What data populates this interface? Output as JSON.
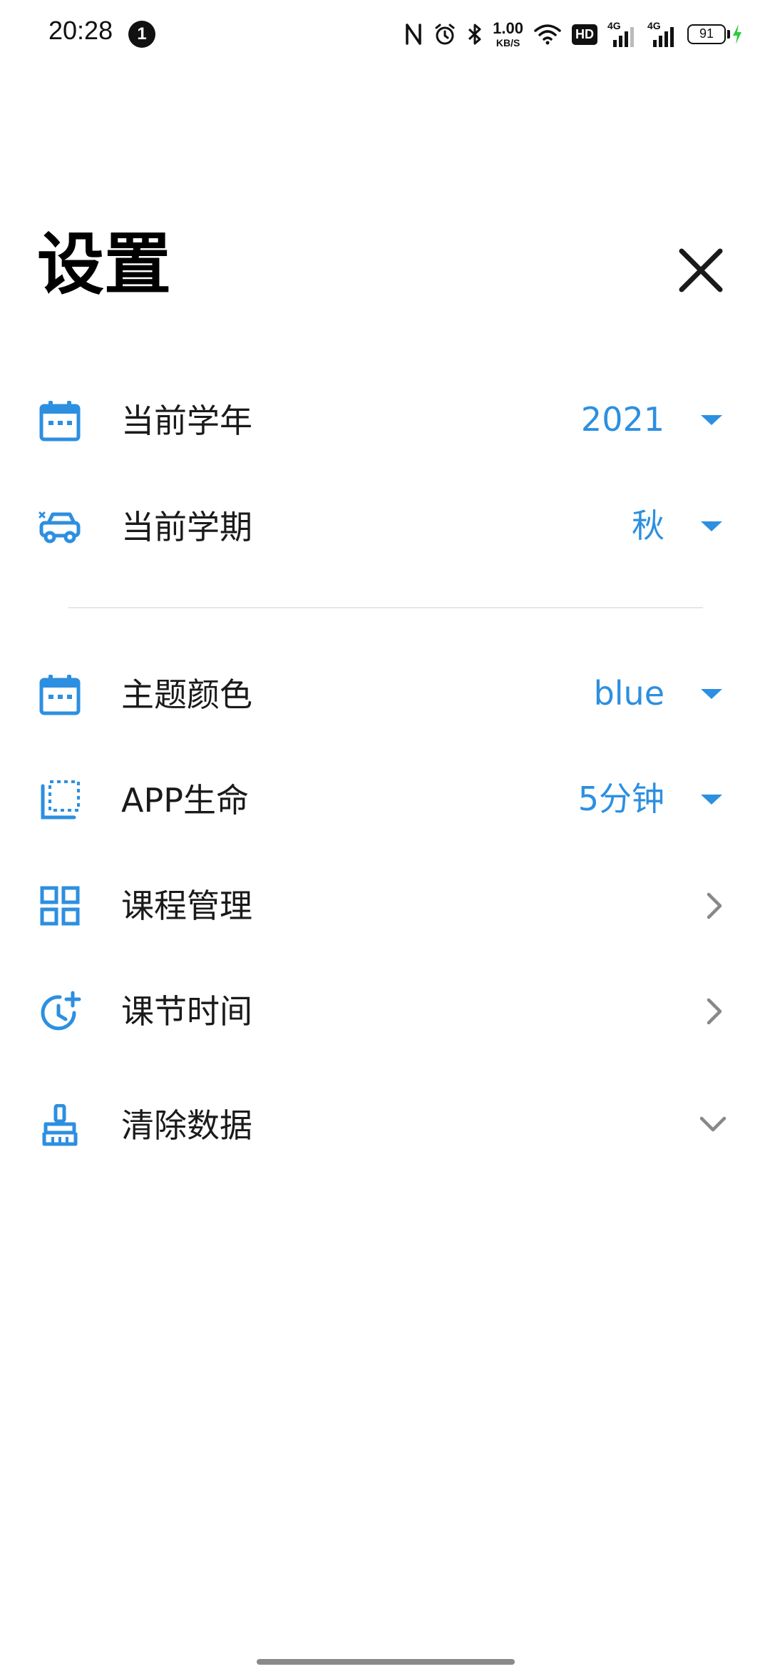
{
  "status_bar": {
    "time": "20:28",
    "notification_count": "1",
    "net_speed_value": "1.00",
    "net_speed_unit": "KB/S",
    "hd_label": "HD",
    "sim1_label": "4G",
    "sim2_label": "4G",
    "battery_level": "91"
  },
  "header": {
    "title": "设置"
  },
  "settings": {
    "items": [
      {
        "label": "当前学年",
        "value": "2021",
        "icon": "calendar-icon",
        "control": "dropdown"
      },
      {
        "label": "当前学期",
        "value": "秋",
        "icon": "car-icon",
        "control": "dropdown"
      },
      {
        "label": "主题颜色",
        "value": "blue",
        "icon": "calendar-icon",
        "control": "dropdown"
      },
      {
        "label": "APP生命",
        "value": "5分钟",
        "icon": "crop-frame-icon",
        "control": "dropdown"
      },
      {
        "label": "课程管理",
        "icon": "grid-icon",
        "control": "navigate"
      },
      {
        "label": "课节时间",
        "icon": "clock-plus-icon",
        "control": "navigate"
      },
      {
        "label": "清除数据",
        "icon": "broom-icon",
        "control": "expand"
      }
    ]
  },
  "colors": {
    "accent": "#2d8fe0",
    "title": "#000000",
    "chevron": "#888888"
  }
}
